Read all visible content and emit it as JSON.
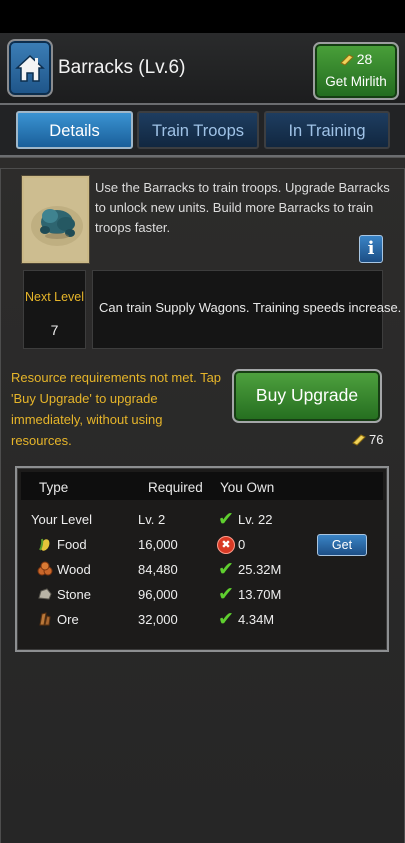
{
  "header": {
    "title": "Barracks (Lv.6)",
    "mirlith_count": "28",
    "mirlith_label": "Get Mirlith"
  },
  "tabs": [
    {
      "label": "Details",
      "active": true
    },
    {
      "label": "Train Troops",
      "active": false
    },
    {
      "label": "In Training",
      "active": false
    }
  ],
  "details": {
    "description": "Use the Barracks to train troops. Upgrade Barracks to unlock new units. Build more Barracks to train troops faster.",
    "next_level_label": "Next Level",
    "next_level_value": "7",
    "next_level_desc": "Can train Supply Wagons. Training speeds increase."
  },
  "upgrade": {
    "warning": "Resource requirements not met. Tap 'Buy Upgrade' to upgrade immediately, without using resources.",
    "button_label": "Buy Upgrade",
    "cost": "76"
  },
  "requirements": {
    "columns": [
      "Type",
      "Required",
      "You Own"
    ],
    "rows": [
      {
        "type": "Your Level",
        "icon": "",
        "required": "Lv. 2",
        "own": "Lv. 22",
        "met": true
      },
      {
        "type": "Food",
        "icon": "food-icon",
        "required": "16,000",
        "own": "0",
        "met": false,
        "action": "Get"
      },
      {
        "type": "Wood",
        "icon": "wood-icon",
        "required": "84,480",
        "own": "25.32M",
        "met": true
      },
      {
        "type": "Stone",
        "icon": "stone-icon",
        "required": "96,000",
        "own": "13.70M",
        "met": true
      },
      {
        "type": "Ore",
        "icon": "ore-icon",
        "required": "32,000",
        "own": "4.34M",
        "met": true
      }
    ]
  },
  "colors": {
    "accent_gold": "#e6b52a",
    "button_green": "#3f8f33",
    "tab_blue": "#2a7dbd",
    "check_green": "#5fcf2f",
    "cross_red": "#d93a25"
  }
}
